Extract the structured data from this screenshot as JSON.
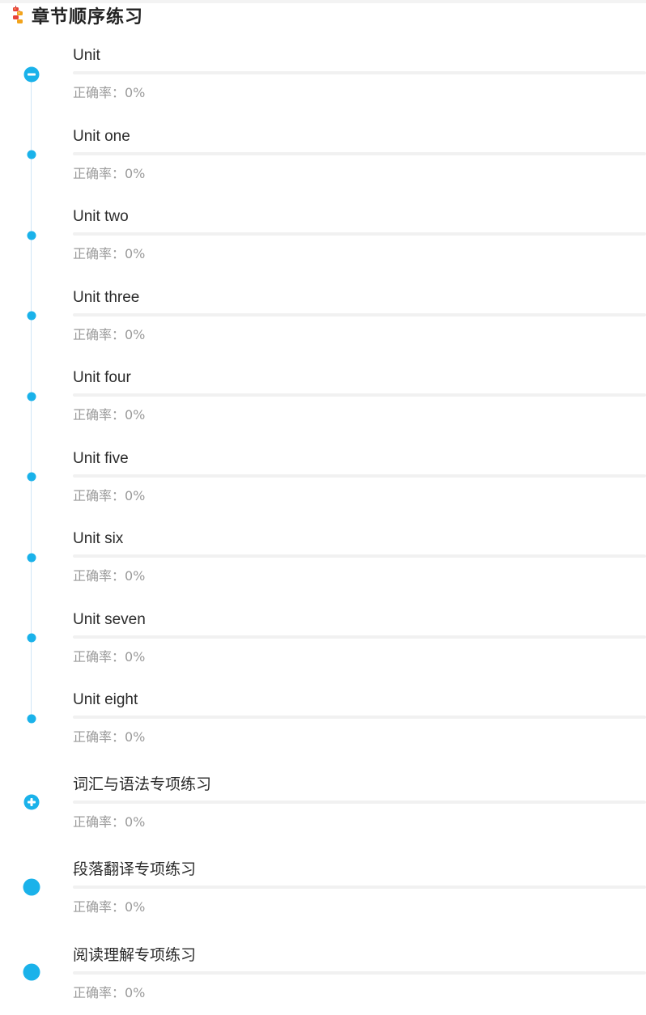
{
  "header": {
    "title": "章节顺序练习",
    "icon": "firecracker-icon"
  },
  "colors": {
    "accent": "#1ab2ea",
    "timeline": "#cfe6f7",
    "track": "#f1f1f1",
    "muted_text": "#9a9a9a"
  },
  "chapters": [
    {
      "title": "Unit",
      "accuracy_text": "正确率：0%",
      "progress": 0,
      "marker": "collapse-icon",
      "sections": [
        {
          "title": "Unit one",
          "accuracy_text": "正确率：0%",
          "progress": 0
        },
        {
          "title": "Unit two",
          "accuracy_text": "正确率：0%",
          "progress": 0
        },
        {
          "title": "Unit three",
          "accuracy_text": "正确率：0%",
          "progress": 0
        },
        {
          "title": "Unit four",
          "accuracy_text": "正确率：0%",
          "progress": 0
        },
        {
          "title": "Unit five",
          "accuracy_text": "正确率：0%",
          "progress": 0
        },
        {
          "title": "Unit six",
          "accuracy_text": "正确率：0%",
          "progress": 0
        },
        {
          "title": "Unit seven",
          "accuracy_text": "正确率：0%",
          "progress": 0
        },
        {
          "title": "Unit eight",
          "accuracy_text": "正确率：0%",
          "progress": 0
        }
      ]
    },
    {
      "title": "词汇与语法专项练习",
      "accuracy_text": "正确率：0%",
      "progress": 0,
      "marker": "expand-icon"
    },
    {
      "title": "段落翻译专项练习",
      "accuracy_text": "正确率：0%",
      "progress": 0,
      "marker": "chapter-dot-icon"
    },
    {
      "title": "阅读理解专项练习",
      "accuracy_text": "正确率：0%",
      "progress": 0,
      "marker": "chapter-dot-icon"
    }
  ]
}
